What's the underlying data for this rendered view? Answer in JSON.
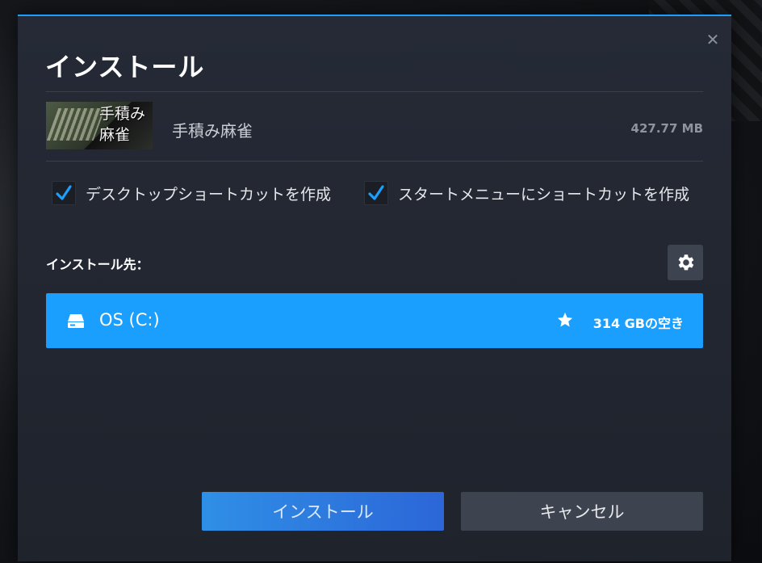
{
  "dialog": {
    "title": "インストール",
    "close_icon": "close-icon"
  },
  "game": {
    "name": "手積み麻雀",
    "size": "427.77 MB",
    "thumbnail_text": "手積み麻雀"
  },
  "options": [
    {
      "label": "デスクトップショートカットを作成",
      "checked": true
    },
    {
      "label": "スタートメニューにショートカットを作成",
      "checked": true
    }
  ],
  "destination": {
    "label": "インストール先：",
    "settings_icon": "gear-icon",
    "drive": {
      "name": "OS (C:)",
      "icon": "drive-icon",
      "default_icon": "star-icon",
      "free_space": "314 GBの空き"
    }
  },
  "buttons": {
    "install": "インストール",
    "cancel": "キャンセル"
  },
  "colors": {
    "accent": "#1a9fff",
    "dialog_bg": "#232833",
    "button_secondary": "#3d4450"
  }
}
